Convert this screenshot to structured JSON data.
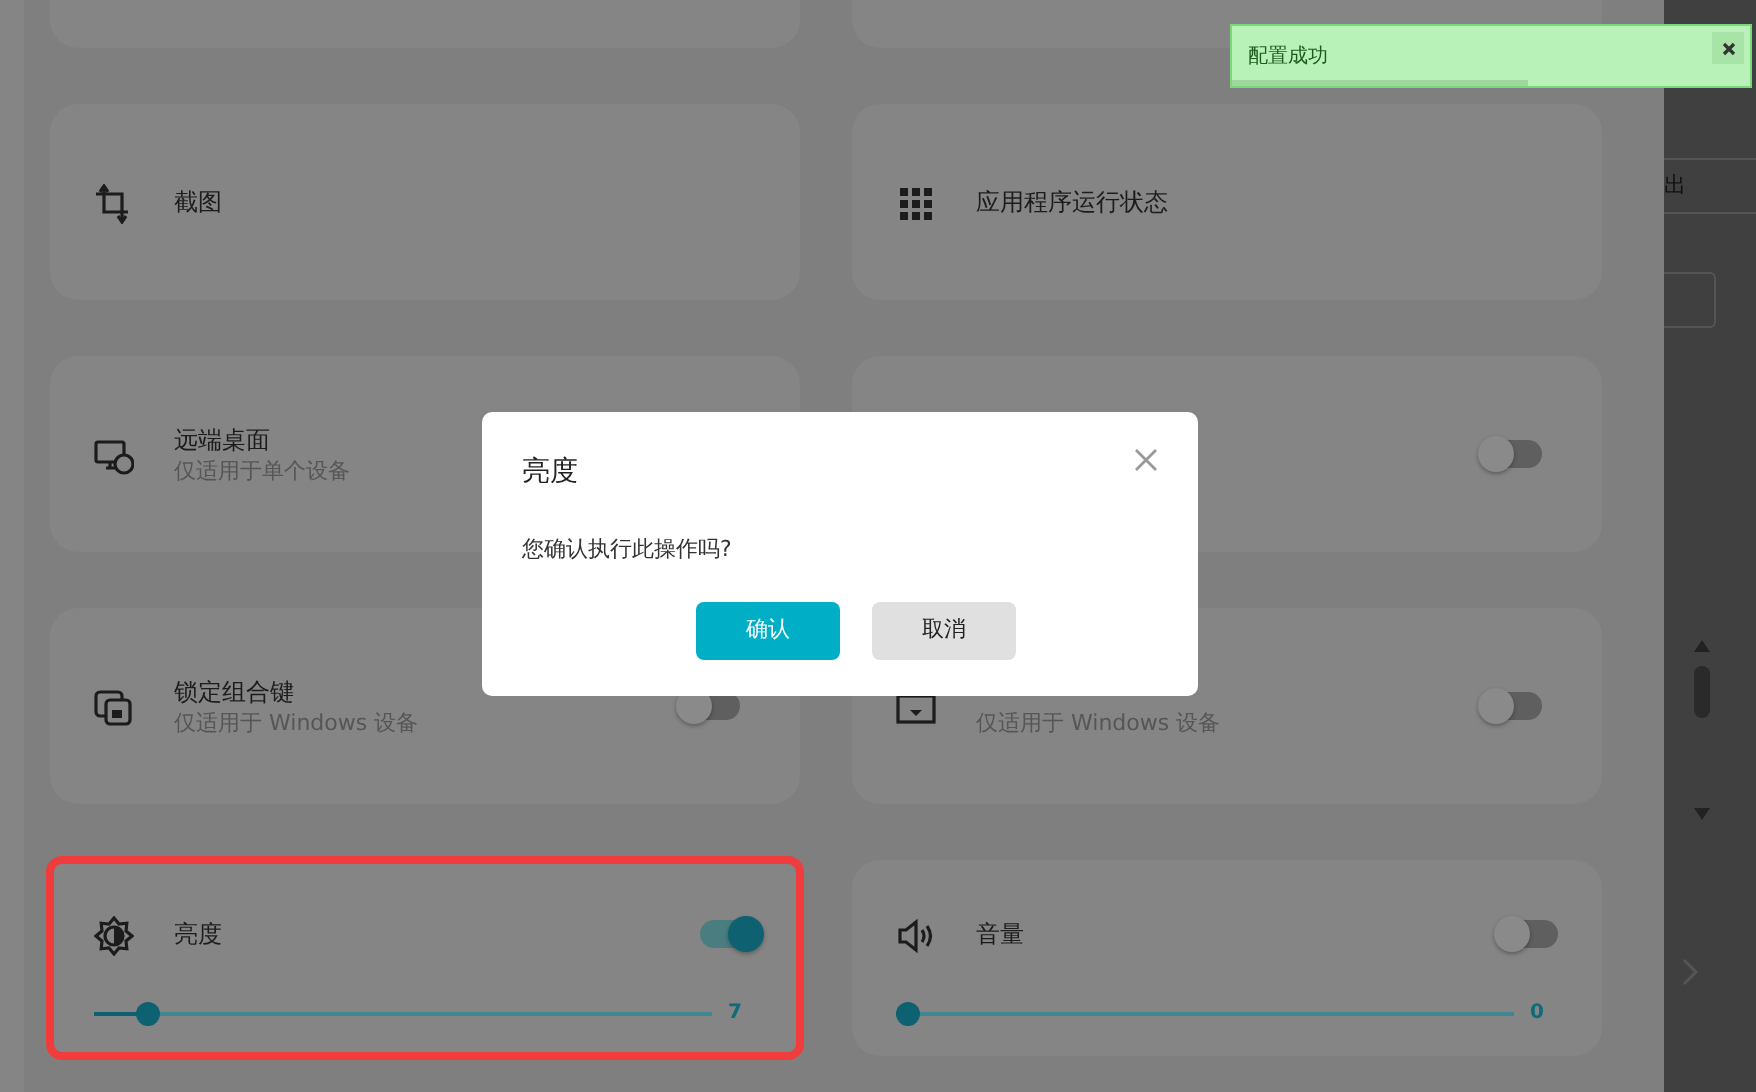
{
  "cards": [
    {
      "kind": "empty"
    },
    {
      "kind": "empty"
    },
    {
      "kind": "plain",
      "title": "截图"
    },
    {
      "kind": "plain",
      "title": "应用程序运行状态"
    },
    {
      "kind": "subtitled",
      "title": "远端桌面",
      "subtitle": "仅适用于单个设备"
    },
    {
      "kind": "toggle",
      "on": false
    },
    {
      "kind": "toggle",
      "title": "锁定组合键",
      "subtitle": "仅适用于 Windows 设备",
      "on": false
    },
    {
      "kind": "toggle",
      "subtitle": "仅适用于 Windows 设备",
      "on": false
    },
    {
      "kind": "slider",
      "title": "亮度",
      "on": true,
      "level": 0.07,
      "reading": "7",
      "highlighted": true
    },
    {
      "kind": "slider",
      "title": "音量",
      "on": false,
      "level": 0,
      "reading": "0",
      "highlighted": false
    }
  ],
  "side_panel": {
    "label": "出"
  },
  "dialog": {
    "title": "亮度",
    "message": "您确认执行此操作吗?",
    "buttons": [
      {
        "label": "确认",
        "kind": "primary"
      },
      {
        "label": "取消",
        "kind": "secondary"
      }
    ]
  },
  "toast": {
    "message": "配置成功",
    "level": 0.57
  }
}
